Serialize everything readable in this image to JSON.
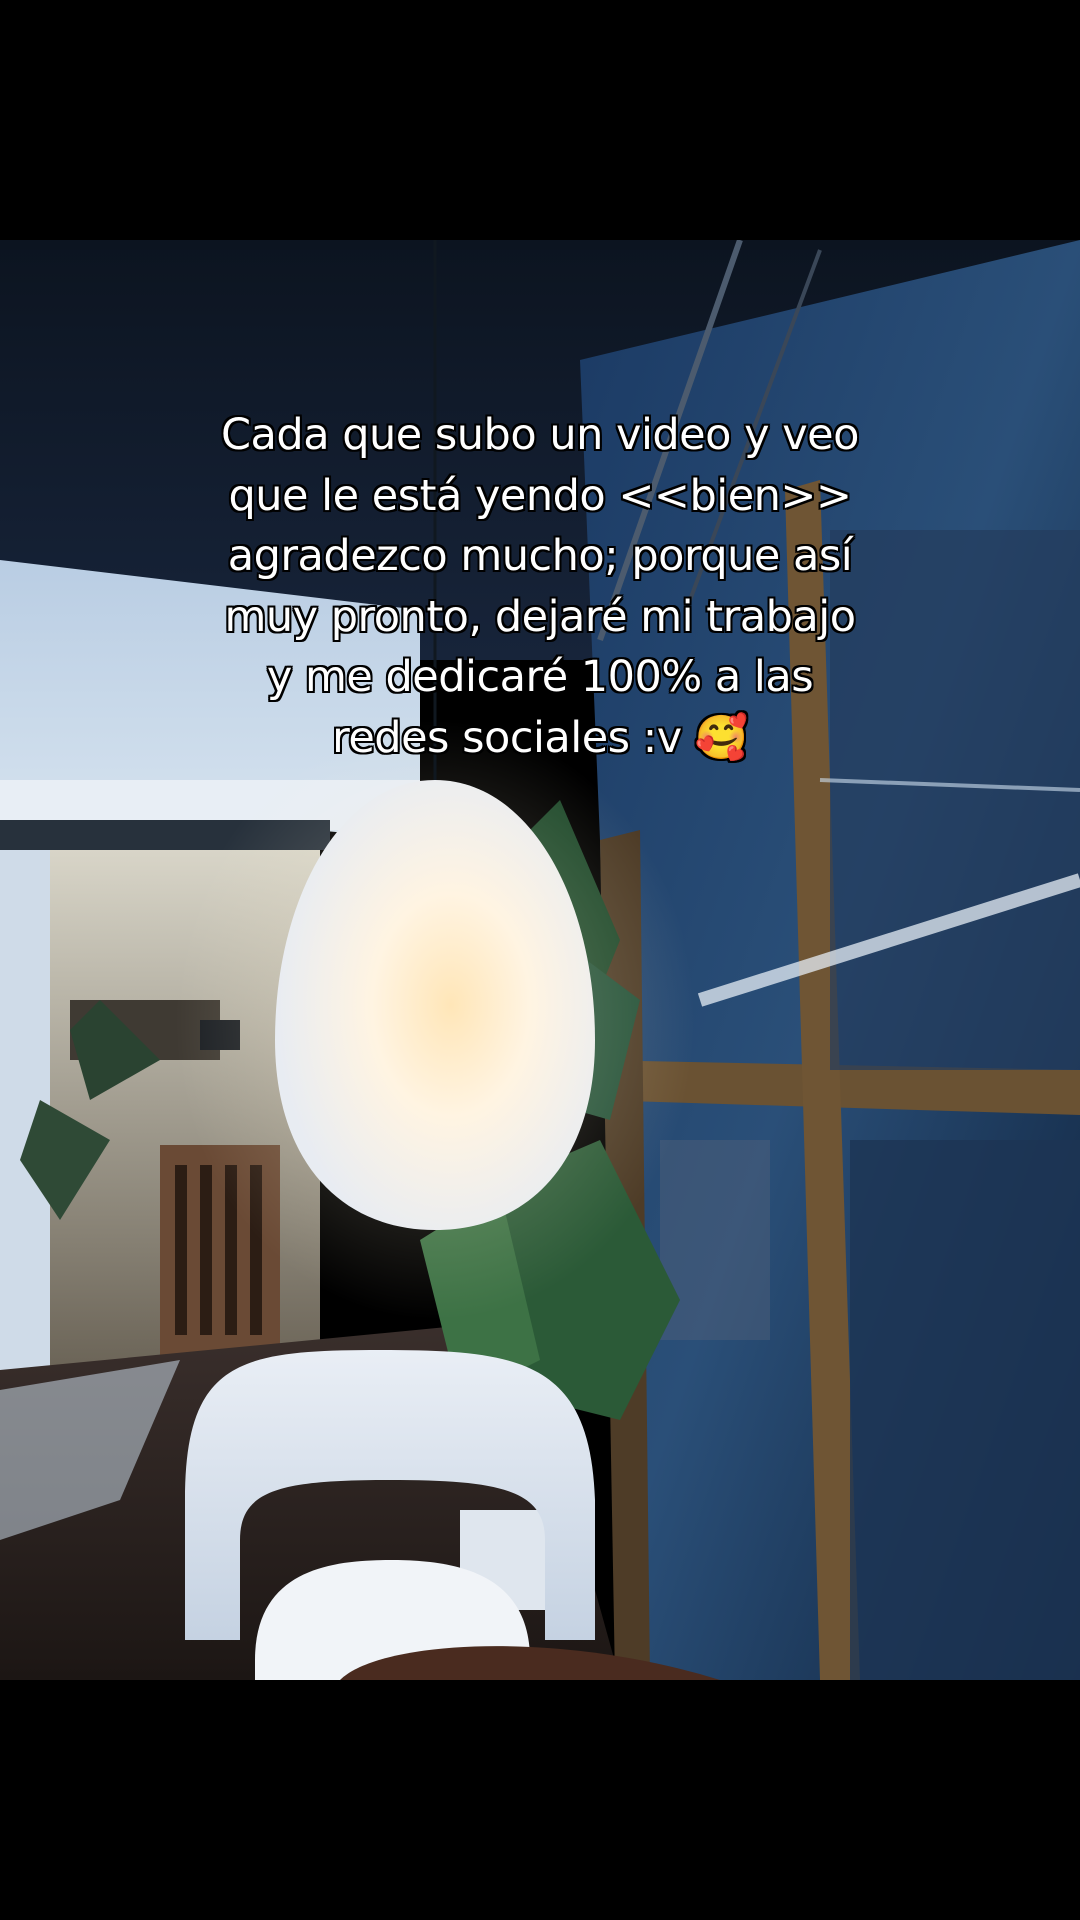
{
  "overlay_text": {
    "lines": [
      "Cada que subo un video y veo",
      "que le está yendo <<bien>>",
      "agradezco mucho; porque así",
      "muy pronto,  dejaré mi trabajo",
      "y me dedicaré 100% a las",
      "redes sociales :v 🥰"
    ]
  },
  "colors": {
    "letterbox": "#000000",
    "caption_text": "#ffffff",
    "caption_outline": "#000000",
    "lamp_glow": "#fff3d6",
    "night_blue": "#1f3550"
  }
}
